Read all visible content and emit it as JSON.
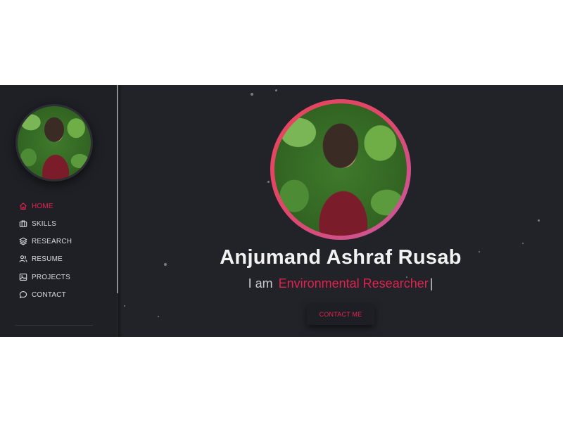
{
  "sidebar": {
    "avatar_icon": "profile-photo",
    "items": [
      {
        "label": "HOME",
        "icon": "home-icon",
        "active": true
      },
      {
        "label": "SKILLS",
        "icon": "briefcase-icon",
        "active": false
      },
      {
        "label": "RESEARCH",
        "icon": "layers-icon",
        "active": false
      },
      {
        "label": "RESUME",
        "icon": "users-icon",
        "active": false
      },
      {
        "label": "PROJECTS",
        "icon": "image-icon",
        "active": false
      },
      {
        "label": "CONTACT",
        "icon": "chat-icon",
        "active": false
      }
    ]
  },
  "hero": {
    "name": "Anjumand Ashraf Rusab",
    "intro": "I am",
    "role": "Environmental Researcher",
    "cursor": "|",
    "contact_button": "CONTACT ME"
  },
  "colors": {
    "accent": "#e5234f",
    "background": "#222329",
    "sidebar": "#1f2026",
    "ring_start": "#e7455c",
    "ring_end": "#c659a0"
  }
}
